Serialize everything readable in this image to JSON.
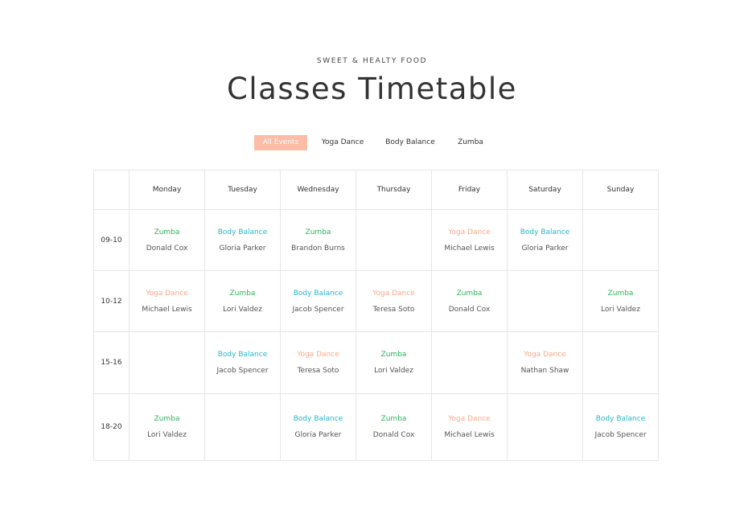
{
  "header": {
    "eyebrow": "SWEET & HEALTY FOOD",
    "title": "Classes Timetable"
  },
  "filters": [
    {
      "label": "All Events",
      "active": true
    },
    {
      "label": "Yoga Dance",
      "active": false
    },
    {
      "label": "Body Balance",
      "active": false
    },
    {
      "label": "Zumba",
      "active": false
    }
  ],
  "colors": {
    "accent": "#fdbca5",
    "zumba": "#2fb25a",
    "body_balance": "#26b5c8",
    "yoga_dance": "#fca889",
    "grid": "#e6e6e6"
  },
  "timetable": {
    "days": [
      "Monday",
      "Tuesday",
      "Wednesday",
      "Thursday",
      "Friday",
      "Saturday",
      "Sunday"
    ],
    "rows": [
      {
        "time": "09-10",
        "cells": [
          {
            "name": "Zumba",
            "trainer": "Donald Cox",
            "type": "zumba"
          },
          {
            "name": "Body Balance",
            "trainer": "Gloria Parker",
            "type": "body-balance"
          },
          {
            "name": "Zumba",
            "trainer": "Brandon Burns",
            "type": "zumba"
          },
          null,
          {
            "name": "Yoga Dance",
            "trainer": "Michael Lewis",
            "type": "yoga-dance"
          },
          {
            "name": "Body Balance",
            "trainer": "Gloria Parker",
            "type": "body-balance"
          },
          null
        ]
      },
      {
        "time": "10-12",
        "cells": [
          {
            "name": "Yoga Dance",
            "trainer": "Michael Lewis",
            "type": "yoga-dance"
          },
          {
            "name": "Zumba",
            "trainer": "Lori Valdez",
            "type": "zumba"
          },
          {
            "name": "Body Balance",
            "trainer": "Jacob Spencer",
            "type": "body-balance"
          },
          {
            "name": "Yoga Dance",
            "trainer": "Teresa Soto",
            "type": "yoga-dance"
          },
          {
            "name": "Zumba",
            "trainer": "Donald Cox",
            "type": "zumba"
          },
          null,
          {
            "name": "Zumba",
            "trainer": "Lori Valdez",
            "type": "zumba"
          }
        ]
      },
      {
        "time": "15-16",
        "cells": [
          null,
          {
            "name": "Body Balance",
            "trainer": "Jacob Spencer",
            "type": "body-balance"
          },
          {
            "name": "Yoga Dance",
            "trainer": "Teresa Soto",
            "type": "yoga-dance"
          },
          {
            "name": "Zumba",
            "trainer": "Lori Valdez",
            "type": "zumba"
          },
          null,
          {
            "name": "Yoga Dance",
            "trainer": "Nathan Shaw",
            "type": "yoga-dance"
          },
          null
        ]
      },
      {
        "time": "18-20",
        "cells": [
          {
            "name": "Zumba",
            "trainer": "Lori Valdez",
            "type": "zumba"
          },
          null,
          {
            "name": "Body Balance",
            "trainer": "Gloria Parker",
            "type": "body-balance"
          },
          {
            "name": "Zumba",
            "trainer": "Donald Cox",
            "type": "zumba"
          },
          {
            "name": "Yoga Dance",
            "trainer": "Michael Lewis",
            "type": "yoga-dance"
          },
          null,
          {
            "name": "Body Balance",
            "trainer": "Jacob Spencer",
            "type": "body-balance"
          }
        ]
      }
    ]
  }
}
